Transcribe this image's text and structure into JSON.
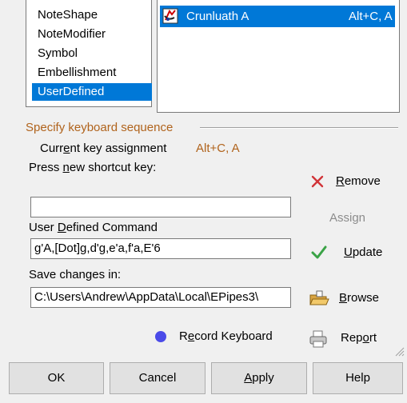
{
  "categories": {
    "items": [
      {
        "label": "NoteShape",
        "selected": false
      },
      {
        "label": "NoteModifier",
        "selected": false
      },
      {
        "label": "Symbol",
        "selected": false
      },
      {
        "label": "Embellishment",
        "selected": false
      },
      {
        "label": "UserDefined",
        "selected": true
      }
    ]
  },
  "commands": {
    "rows": [
      {
        "name": "Crunluath A",
        "shortcut": "Alt+C, A",
        "icon": "bagpipe-music-icon"
      }
    ]
  },
  "keyboard": {
    "section_title": "Specify keyboard sequence",
    "current_label_pre": "Curr",
    "current_label_u": "e",
    "current_label_post": "nt key assignment",
    "current_value": "Alt+C, A",
    "press_label_pre": "Press ",
    "press_label_u": "n",
    "press_label_post": "ew shortcut key:",
    "shortcut_value": "",
    "udc_label_pre": "User ",
    "udc_label_u": "D",
    "udc_label_post": "efined Command",
    "udc_value": "g'A,[Dot]g,d'g,e'a,f'a,E'6",
    "save_label": "Save changes in:",
    "save_value": "C:\\Users\\Andrew\\AppData\\Local\\EPipes3\\",
    "record_label_pre": "R",
    "record_label_u": "e",
    "record_label_post": "cord Keyboard"
  },
  "actions": {
    "remove_u": "R",
    "remove_rest": "emove",
    "assign": "Assign",
    "update_u": "U",
    "update_rest": "pdate",
    "browse_u": "B",
    "browse_rest": "rowse",
    "report_pre": "Rep",
    "report_u": "o",
    "report_post": "rt"
  },
  "footer": {
    "ok": "OK",
    "cancel": "Cancel",
    "apply_u": "A",
    "apply_rest": "pply",
    "help": "Help"
  },
  "colors": {
    "selection": "#0078d7",
    "section_title": "#b0631c",
    "remove_icon": "#d13438",
    "update_icon": "#3aa346",
    "record_dot": "#4a4ae8"
  }
}
